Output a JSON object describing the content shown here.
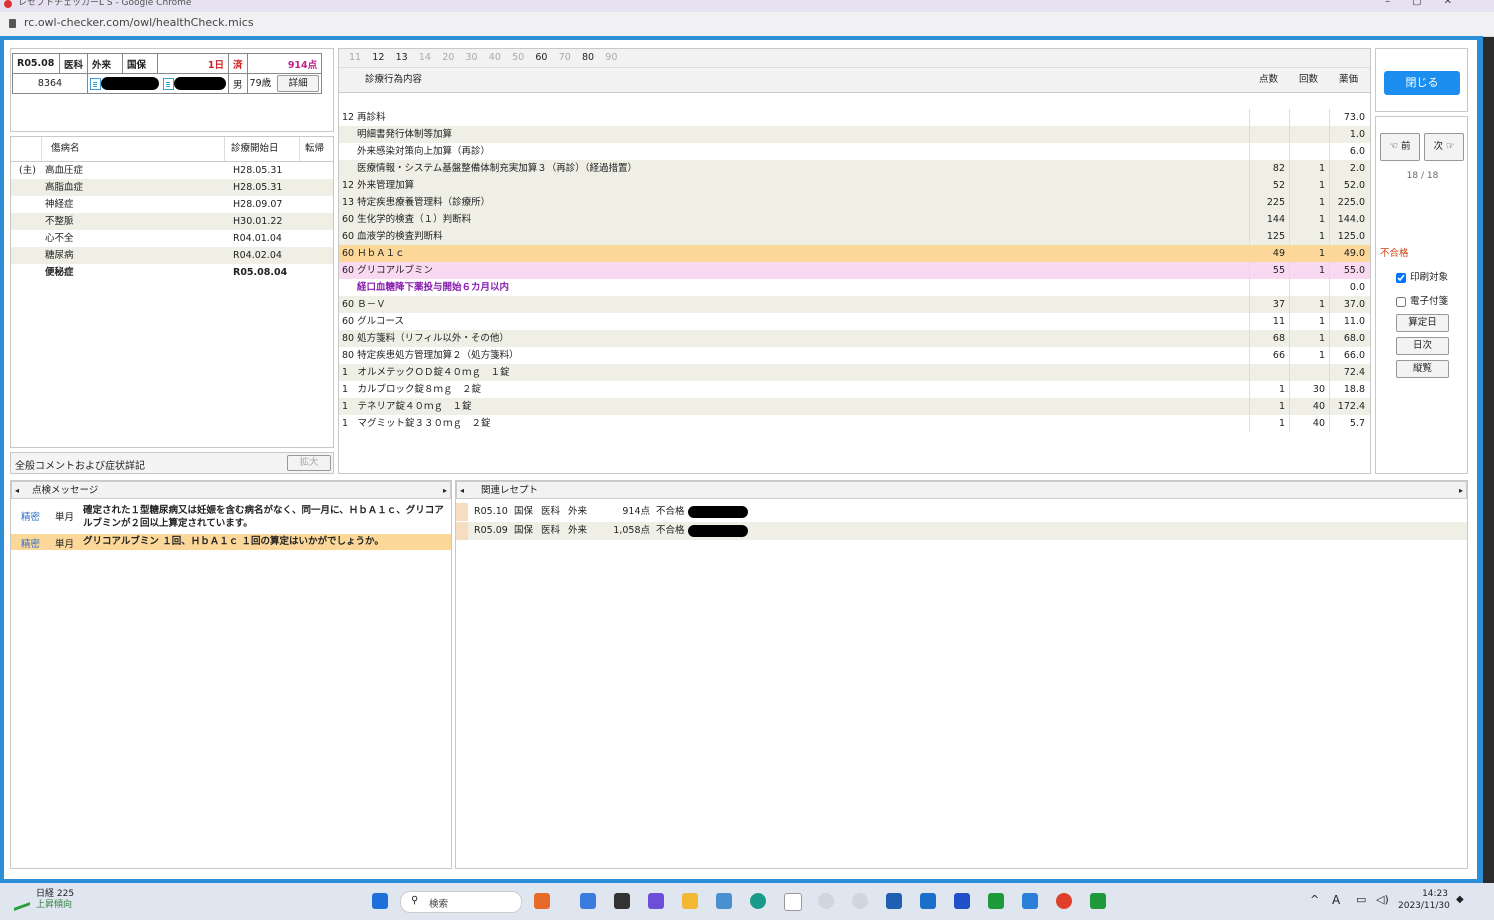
{
  "browser": {
    "title": "レセプトチェッカーL S - Google Chrome",
    "url": "rc.owl-checker.com/owl/healthCheck.mics",
    "window_controls": "–▢✕"
  },
  "patient": {
    "month": "R05.08",
    "type1": "医科",
    "type2": "外来",
    "insurance": "国保",
    "days": "1日",
    "status": "済",
    "points": "914点",
    "id": "8364",
    "sex": "男",
    "age": "79歳",
    "detail_button": "詳細"
  },
  "disease": {
    "headers": {
      "name": "傷病名",
      "start": "診療開始日",
      "outcome": "転帰"
    },
    "rows": [
      {
        "mark": "(主)",
        "name": "高血圧症",
        "date": "H28.05.31",
        "bold": false
      },
      {
        "mark": "",
        "name": "高脂血症",
        "date": "H28.05.31",
        "bold": false
      },
      {
        "mark": "",
        "name": "神経症",
        "date": "H28.09.07",
        "bold": false
      },
      {
        "mark": "",
        "name": "不整脈",
        "date": "H30.01.22",
        "bold": false
      },
      {
        "mark": "",
        "name": "心不全",
        "date": "R04.01.04",
        "bold": false
      },
      {
        "mark": "",
        "name": "糖尿病",
        "date": "R04.02.04",
        "bold": false
      },
      {
        "mark": "",
        "name": "便秘症",
        "date": "R05.08.04",
        "bold": true
      }
    ],
    "comment_label": "全般コメントおよび症状詳記",
    "expand_button": "拡大"
  },
  "services": {
    "tab_numbers": [
      {
        "n": "11",
        "active": false
      },
      {
        "n": "12",
        "active": true
      },
      {
        "n": "13",
        "active": true
      },
      {
        "n": "14",
        "active": false
      },
      {
        "n": "20",
        "active": false
      },
      {
        "n": "30",
        "active": false
      },
      {
        "n": "40",
        "active": false
      },
      {
        "n": "50",
        "active": false
      },
      {
        "n": "60",
        "active": true
      },
      {
        "n": "70",
        "active": false
      },
      {
        "n": "80",
        "active": true
      },
      {
        "n": "90",
        "active": false
      }
    ],
    "headers": {
      "content": "診療行為内容",
      "points": "点数",
      "count": "回数",
      "price": "薬価"
    },
    "rows": [
      {
        "text": "12 再診料",
        "points": "",
        "count": "",
        "price": "73.0",
        "indent": false,
        "style": ""
      },
      {
        "text": "明細書発行体制等加算",
        "points": "",
        "count": "",
        "price": "1.0",
        "indent": true,
        "style": ""
      },
      {
        "text": "外来感染対策向上加算（再診）",
        "points": "",
        "count": "",
        "price": "6.0",
        "indent": true,
        "style": ""
      },
      {
        "text": "医療情報・システム基盤整備体制充実加算３（再診）（経過措置）",
        "points": "82",
        "count": "1",
        "price": "2.0",
        "indent": true,
        "style": ""
      },
      {
        "text": "12 外来管理加算",
        "points": "52",
        "count": "1",
        "price": "52.0",
        "indent": false,
        "style": "alt"
      },
      {
        "text": "13 特定疾患療養管理料（診療所）",
        "points": "225",
        "count": "1",
        "price": "225.0",
        "indent": false,
        "style": ""
      },
      {
        "text": "60 生化学的検査（１）判断料",
        "points": "144",
        "count": "1",
        "price": "144.0",
        "indent": false,
        "style": "alt"
      },
      {
        "text": "60 血液学的検査判断料",
        "points": "125",
        "count": "1",
        "price": "125.0",
        "indent": false,
        "style": ""
      },
      {
        "text": "60 ＨｂＡ１ｃ",
        "points": "49",
        "count": "1",
        "price": "49.0",
        "indent": false,
        "style": "orange"
      },
      {
        "text": "60 グリコアルブミン",
        "points": "55",
        "count": "1",
        "price": "55.0",
        "indent": false,
        "style": "pink"
      },
      {
        "text": "経口血糖降下薬投与開始６カ月以内",
        "points": "",
        "count": "",
        "price": "0.0",
        "indent": true,
        "style": "purple"
      },
      {
        "text": "60 Ｂ－Ｖ",
        "points": "37",
        "count": "1",
        "price": "37.0",
        "indent": false,
        "style": "alt"
      },
      {
        "text": "60 グルコース",
        "points": "11",
        "count": "1",
        "price": "11.0",
        "indent": false,
        "style": ""
      },
      {
        "text": "80 処方箋料（リフィル以外・その他）",
        "points": "68",
        "count": "1",
        "price": "68.0",
        "indent": false,
        "style": "alt"
      },
      {
        "text": "80 特定疾患処方管理加算２（処方箋料）",
        "points": "66",
        "count": "1",
        "price": "66.0",
        "indent": false,
        "style": ""
      },
      {
        "text": "1　オルメテックＯＤ錠４０ｍｇ　１錠",
        "points": "",
        "count": "",
        "price": "72.4",
        "indent": false,
        "style": "alt"
      },
      {
        "text": "1　カルブロック錠８ｍｇ　２錠",
        "points": "1",
        "count": "30",
        "price": "18.8",
        "indent": false,
        "style": ""
      },
      {
        "text": "1　テネリア錠４０ｍｇ　１錠",
        "points": "1",
        "count": "40",
        "price": "172.4",
        "indent": false,
        "style": "alt"
      },
      {
        "text": "1　マグミット錠３３０ｍｇ　２錠",
        "points": "1",
        "count": "40",
        "price": "5.7",
        "indent": false,
        "style": ""
      }
    ]
  },
  "side": {
    "close_button": "閉じる",
    "prev_button": "前",
    "next_button": "次",
    "counter": "18 / 18",
    "status": "不合格",
    "print_label": "印刷対象",
    "print_checked": true,
    "esign_label": "電子付箋",
    "esign_checked": false,
    "calc_date_button": "算定日",
    "daily_button": "日次",
    "vertical_button": "縦覧"
  },
  "messages": {
    "title": "点検メッセージ",
    "rows": [
      {
        "level": "精密",
        "period": "単月",
        "text": "確定された１型糖尿病又は妊娠を含む病名がなく、同一月に、ＨｂＡ１ｃ、グリコアルブミンが２回以上算定されています。",
        "highlight": false
      },
      {
        "level": "精密",
        "period": "単月",
        "text": "グリコアルブミン １回、ＨｂＡ１ｃ １回の算定はいかがでしょうか。",
        "highlight": true
      }
    ]
  },
  "related": {
    "title": "関連レセプト",
    "rows": [
      {
        "month": "R05.10",
        "ins": "国保",
        "type1": "医科",
        "type2": "外来",
        "points": "914点",
        "result": "不合格"
      },
      {
        "month": "R05.09",
        "ins": "国保",
        "type1": "医科",
        "type2": "外来",
        "points": "1,058点",
        "result": "不合格"
      }
    ]
  },
  "taskbar": {
    "stock_name": "日経 225",
    "stock_trend": "上昇傾向",
    "search": "検索",
    "time": "14:23",
    "date": "2023/11/30",
    "ime": "A"
  }
}
